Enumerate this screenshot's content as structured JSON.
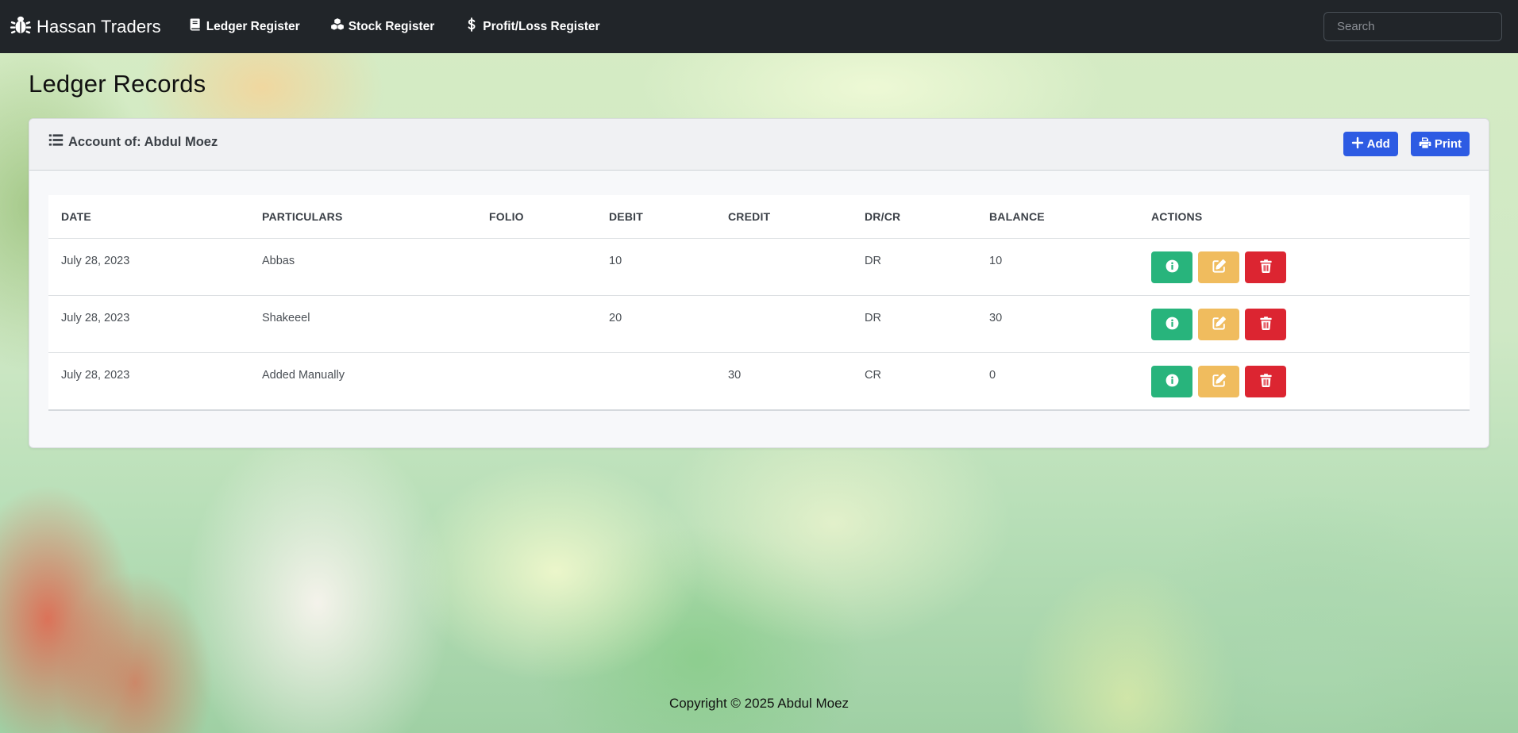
{
  "navbar": {
    "brand": "Hassan Traders",
    "links": [
      {
        "label": "Ledger Register",
        "icon": "book-icon"
      },
      {
        "label": "Stock Register",
        "icon": "cubes-icon"
      },
      {
        "label": "Profit/Loss Register",
        "icon": "dollar-icon"
      }
    ],
    "search_placeholder": "Search"
  },
  "page": {
    "title": "Ledger Records"
  },
  "card": {
    "title": "Account of: Abdul Moez",
    "add_label": "Add",
    "print_label": "Print"
  },
  "table": {
    "columns": [
      "DATE",
      "PARTICULARS",
      "FOLIO",
      "DEBIT",
      "CREDIT",
      "DR/CR",
      "BALANCE",
      "ACTIONS"
    ],
    "rows": [
      {
        "date": "July 28, 2023",
        "particulars": "Abbas",
        "folio": "",
        "debit": "10",
        "credit": "",
        "drcr": "DR",
        "balance": "10"
      },
      {
        "date": "July 28, 2023",
        "particulars": "Shakeeel",
        "folio": "",
        "debit": "20",
        "credit": "",
        "drcr": "DR",
        "balance": "30"
      },
      {
        "date": "July 28, 2023",
        "particulars": "Added Manually",
        "folio": "",
        "debit": "",
        "credit": "30",
        "drcr": "CR",
        "balance": "0"
      }
    ]
  },
  "colors": {
    "navbar": "#212529",
    "primary": "#2d5be3",
    "info_button": "#28b47c",
    "edit_button": "#f0bc5e",
    "delete_button": "#dc2531"
  },
  "footer": {
    "text": "Copyright © 2025 Abdul Moez"
  }
}
